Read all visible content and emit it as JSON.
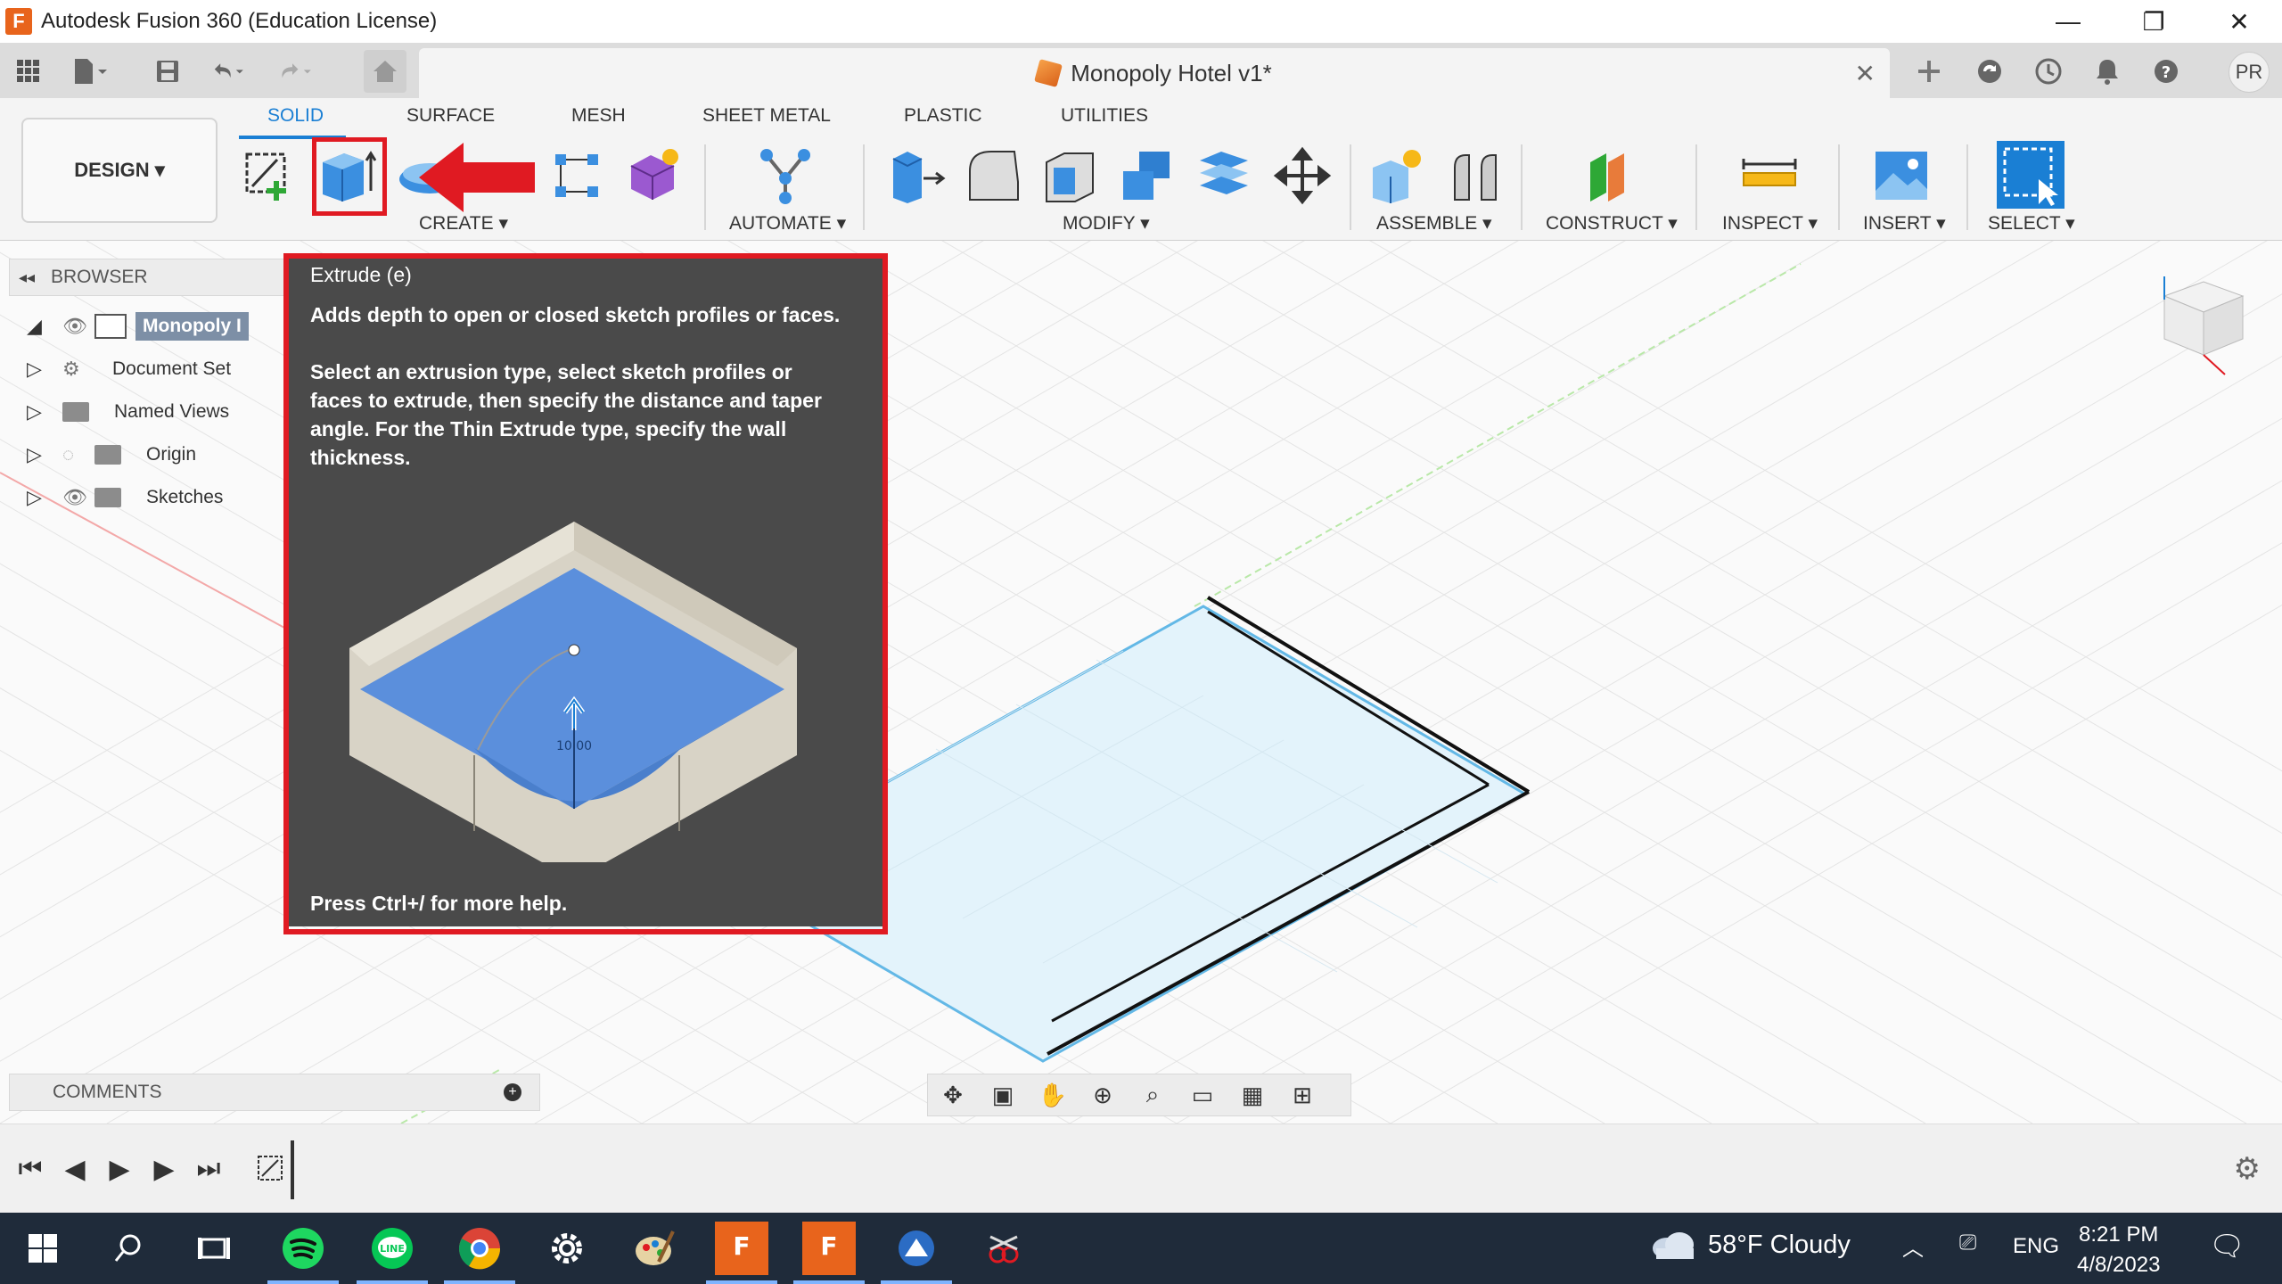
{
  "window": {
    "title": "Autodesk Fusion 360 (Education License)",
    "logo_letter": "F",
    "minimize": "—",
    "restore": "❐",
    "close": "✕"
  },
  "document": {
    "title": "Monopoly Hotel v1*",
    "close": "✕"
  },
  "user": {
    "initials": "PR"
  },
  "workspace": {
    "label": "DESIGN ▾"
  },
  "ribbon_tabs": [
    "SOLID",
    "SURFACE",
    "MESH",
    "SHEET METAL",
    "PLASTIC",
    "UTILITIES"
  ],
  "ribbon_groups": {
    "create": "CREATE ▾",
    "automate": "AUTOMATE ▾",
    "modify": "MODIFY ▾",
    "assemble": "ASSEMBLE ▾",
    "construct": "CONSTRUCT ▾",
    "inspect": "INSPECT ▾",
    "insert": "INSERT ▾",
    "select": "SELECT ▾"
  },
  "browser": {
    "title": "BROWSER",
    "items": [
      {
        "label": "Monopoly I"
      },
      {
        "label": "Document Set"
      },
      {
        "label": "Named Views"
      },
      {
        "label": "Origin"
      },
      {
        "label": "Sketches"
      }
    ]
  },
  "tooltip": {
    "title": "Extrude (e)",
    "summary": "Adds depth to open or closed sketch profiles or faces.",
    "line1": "Select an extrusion type, select sketch profiles or",
    "line2": "faces to extrude, then specify the distance and taper",
    "line3": "angle. For the Thin Extrude type, specify the wall",
    "line4": "thickness.",
    "dimension": "10.00",
    "footer": "Press Ctrl+/ for more help."
  },
  "comments": {
    "title": "COMMENTS"
  },
  "taskbar": {
    "weather": "58°F  Cloudy",
    "lang": "ENG",
    "time": "8:21 PM",
    "date": "4/8/2023"
  },
  "colors": {
    "accent": "#1a7fd4",
    "highlight": "#e01a22",
    "tooltip_bg": "#4a4a4a",
    "taskbar_bg": "#1f2b3a"
  }
}
